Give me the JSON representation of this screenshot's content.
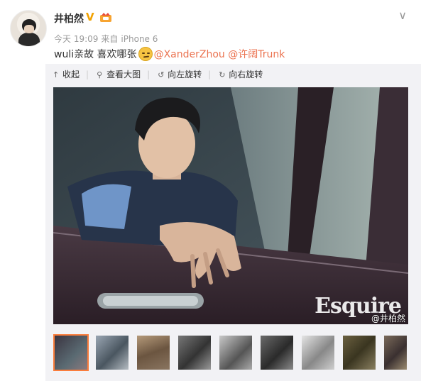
{
  "post": {
    "username": "井柏然",
    "verified_badge": "V",
    "time": "今天 19:09",
    "source_prefix": "来自",
    "source": "iPhone 6",
    "text_prefix": "wuli亲故 喜欢哪张",
    "mention1": "@XanderZhou",
    "mention2": "@许阔Trunk"
  },
  "toolbar": {
    "collapse_label": "收起",
    "collapse_icon": "up-arrow-icon",
    "view_large_label": "查看大图",
    "view_large_icon": "search-icon",
    "rotate_left_label": "向左旋转",
    "rotate_left_icon": "rotate-left-icon",
    "rotate_right_label": "向右旋转",
    "rotate_right_icon": "rotate-right-icon"
  },
  "photo": {
    "watermark_logo": "Esquire",
    "watermark_user": "@井柏然"
  },
  "thumbnails": {
    "count": 9,
    "active_index": 0
  },
  "colors": {
    "link": "#eb7350",
    "active_thumb_border": "#fa7d3c",
    "panel_bg": "#f2f2f5",
    "verified": "#f2a200"
  }
}
